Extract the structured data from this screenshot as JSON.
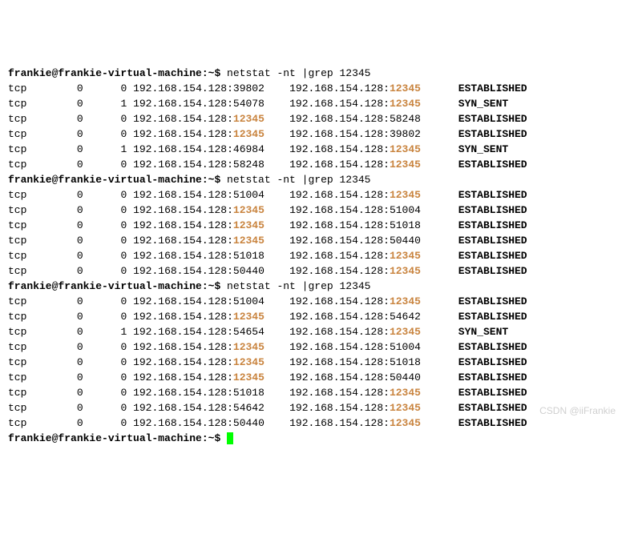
{
  "prompt": "frankie@frankie-virtual-machine:~$ ",
  "command": "netstat -nt |grep 12345",
  "watermark": "CSDN @iiFrankie",
  "blocks": [
    {
      "rows": [
        {
          "proto": "tcp",
          "recv": "0",
          "send": "0",
          "la_ip": "192.168.154.128:",
          "la_port": "39802",
          "la_hl": false,
          "fa_ip": "192.168.154.128:",
          "fa_port": "12345",
          "fa_hl": true,
          "state": "ESTABLISHED"
        },
        {
          "proto": "tcp",
          "recv": "0",
          "send": "1",
          "la_ip": "192.168.154.128:",
          "la_port": "54078",
          "la_hl": false,
          "fa_ip": "192.168.154.128:",
          "fa_port": "12345",
          "fa_hl": true,
          "state": "SYN_SENT"
        },
        {
          "proto": "tcp",
          "recv": "0",
          "send": "0",
          "la_ip": "192.168.154.128:",
          "la_port": "12345",
          "la_hl": true,
          "fa_ip": "192.168.154.128:",
          "fa_port": "58248",
          "fa_hl": false,
          "state": "ESTABLISHED"
        },
        {
          "proto": "tcp",
          "recv": "0",
          "send": "0",
          "la_ip": "192.168.154.128:",
          "la_port": "12345",
          "la_hl": true,
          "fa_ip": "192.168.154.128:",
          "fa_port": "39802",
          "fa_hl": false,
          "state": "ESTABLISHED"
        },
        {
          "proto": "tcp",
          "recv": "0",
          "send": "1",
          "la_ip": "192.168.154.128:",
          "la_port": "46984",
          "la_hl": false,
          "fa_ip": "192.168.154.128:",
          "fa_port": "12345",
          "fa_hl": true,
          "state": "SYN_SENT"
        },
        {
          "proto": "tcp",
          "recv": "0",
          "send": "0",
          "la_ip": "192.168.154.128:",
          "la_port": "58248",
          "la_hl": false,
          "fa_ip": "192.168.154.128:",
          "fa_port": "12345",
          "fa_hl": true,
          "state": "ESTABLISHED"
        }
      ]
    },
    {
      "rows": [
        {
          "proto": "tcp",
          "recv": "0",
          "send": "0",
          "la_ip": "192.168.154.128:",
          "la_port": "51004",
          "la_hl": false,
          "fa_ip": "192.168.154.128:",
          "fa_port": "12345",
          "fa_hl": true,
          "state": "ESTABLISHED"
        },
        {
          "proto": "tcp",
          "recv": "0",
          "send": "0",
          "la_ip": "192.168.154.128:",
          "la_port": "12345",
          "la_hl": true,
          "fa_ip": "192.168.154.128:",
          "fa_port": "51004",
          "fa_hl": false,
          "state": "ESTABLISHED"
        },
        {
          "proto": "tcp",
          "recv": "0",
          "send": "0",
          "la_ip": "192.168.154.128:",
          "la_port": "12345",
          "la_hl": true,
          "fa_ip": "192.168.154.128:",
          "fa_port": "51018",
          "fa_hl": false,
          "state": "ESTABLISHED"
        },
        {
          "proto": "tcp",
          "recv": "0",
          "send": "0",
          "la_ip": "192.168.154.128:",
          "la_port": "12345",
          "la_hl": true,
          "fa_ip": "192.168.154.128:",
          "fa_port": "50440",
          "fa_hl": false,
          "state": "ESTABLISHED"
        },
        {
          "proto": "tcp",
          "recv": "0",
          "send": "0",
          "la_ip": "192.168.154.128:",
          "la_port": "51018",
          "la_hl": false,
          "fa_ip": "192.168.154.128:",
          "fa_port": "12345",
          "fa_hl": true,
          "state": "ESTABLISHED"
        },
        {
          "proto": "tcp",
          "recv": "0",
          "send": "0",
          "la_ip": "192.168.154.128:",
          "la_port": "50440",
          "la_hl": false,
          "fa_ip": "192.168.154.128:",
          "fa_port": "12345",
          "fa_hl": true,
          "state": "ESTABLISHED"
        }
      ]
    },
    {
      "rows": [
        {
          "proto": "tcp",
          "recv": "0",
          "send": "0",
          "la_ip": "192.168.154.128:",
          "la_port": "51004",
          "la_hl": false,
          "fa_ip": "192.168.154.128:",
          "fa_port": "12345",
          "fa_hl": true,
          "state": "ESTABLISHED"
        },
        {
          "proto": "tcp",
          "recv": "0",
          "send": "0",
          "la_ip": "192.168.154.128:",
          "la_port": "12345",
          "la_hl": true,
          "fa_ip": "192.168.154.128:",
          "fa_port": "54642",
          "fa_hl": false,
          "state": "ESTABLISHED"
        },
        {
          "proto": "tcp",
          "recv": "0",
          "send": "1",
          "la_ip": "192.168.154.128:",
          "la_port": "54654",
          "la_hl": false,
          "fa_ip": "192.168.154.128:",
          "fa_port": "12345",
          "fa_hl": true,
          "state": "SYN_SENT"
        },
        {
          "proto": "tcp",
          "recv": "0",
          "send": "0",
          "la_ip": "192.168.154.128:",
          "la_port": "12345",
          "la_hl": true,
          "fa_ip": "192.168.154.128:",
          "fa_port": "51004",
          "fa_hl": false,
          "state": "ESTABLISHED"
        },
        {
          "proto": "tcp",
          "recv": "0",
          "send": "0",
          "la_ip": "192.168.154.128:",
          "la_port": "12345",
          "la_hl": true,
          "fa_ip": "192.168.154.128:",
          "fa_port": "51018",
          "fa_hl": false,
          "state": "ESTABLISHED"
        },
        {
          "proto": "tcp",
          "recv": "0",
          "send": "0",
          "la_ip": "192.168.154.128:",
          "la_port": "12345",
          "la_hl": true,
          "fa_ip": "192.168.154.128:",
          "fa_port": "50440",
          "fa_hl": false,
          "state": "ESTABLISHED"
        },
        {
          "proto": "tcp",
          "recv": "0",
          "send": "0",
          "la_ip": "192.168.154.128:",
          "la_port": "51018",
          "la_hl": false,
          "fa_ip": "192.168.154.128:",
          "fa_port": "12345",
          "fa_hl": true,
          "state": "ESTABLISHED"
        },
        {
          "proto": "tcp",
          "recv": "0",
          "send": "0",
          "la_ip": "192.168.154.128:",
          "la_port": "54642",
          "la_hl": false,
          "fa_ip": "192.168.154.128:",
          "fa_port": "12345",
          "fa_hl": true,
          "state": "ESTABLISHED"
        },
        {
          "proto": "tcp",
          "recv": "0",
          "send": "0",
          "la_ip": "192.168.154.128:",
          "la_port": "50440",
          "la_hl": false,
          "fa_ip": "192.168.154.128:",
          "fa_port": "12345",
          "fa_hl": true,
          "state": "ESTABLISHED"
        }
      ]
    }
  ]
}
